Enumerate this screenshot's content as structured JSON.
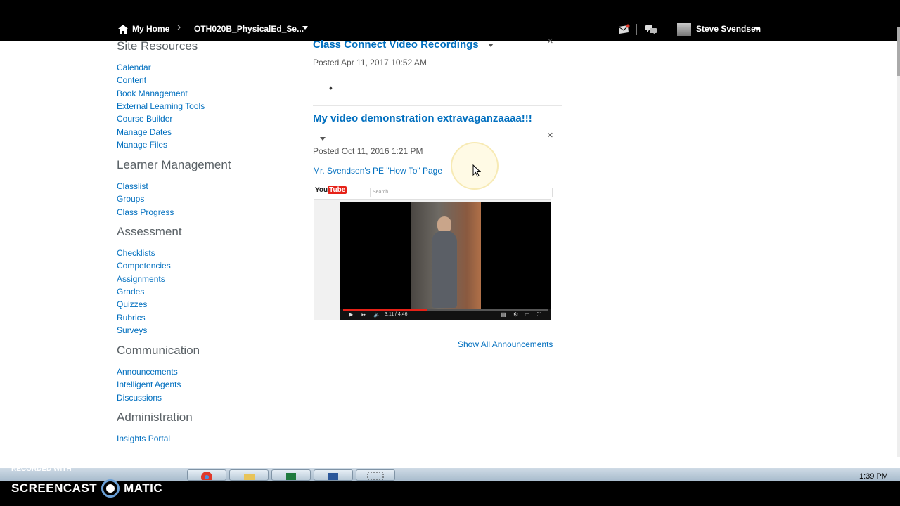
{
  "topbar": {
    "home_label": "My Home",
    "course_label": "OTH020B_PhysicalEd_Se...",
    "user_name": "Steve Svendsen"
  },
  "nav": {
    "sections": [
      {
        "title": "Site Resources",
        "links": [
          "Calendar",
          "Content",
          "Book Management",
          "External Learning Tools",
          "Course Builder",
          "Manage Dates",
          "Manage Files"
        ]
      },
      {
        "title": "Learner Management",
        "links": [
          "Classlist",
          "Groups",
          "Class Progress"
        ]
      },
      {
        "title": "Assessment",
        "links": [
          "Checklists",
          "Competencies",
          "Assignments",
          "Grades",
          "Quizzes",
          "Rubrics",
          "Surveys"
        ]
      },
      {
        "title": "Communication",
        "links": [
          "Announcements",
          "Intelligent Agents",
          "Discussions"
        ]
      },
      {
        "title": "Administration",
        "links": [
          "Insights Portal"
        ]
      }
    ]
  },
  "announcements": [
    {
      "title": "Class Connect Video Recordings",
      "posted": "Posted Apr 11, 2017 10:52 AM",
      "bullet": "•"
    },
    {
      "title": "My video demonstration extravaganzaaaa!!!",
      "posted": "Posted Oct 11, 2016 1:21 PM",
      "link": "Mr. Svendsen's PE \"How To\" Page",
      "video": {
        "logo_you": "You",
        "logo_tube": "Tube",
        "search_placeholder": "Search",
        "time": "3:11 / 4:46"
      }
    }
  ],
  "show_all_label": "Show All Announcements",
  "taskbar": {
    "clock": "1:39 PM"
  },
  "recorder": {
    "with": "RECORDED WITH",
    "brand_left": "SCREENCAST",
    "brand_right": "MATIC"
  }
}
